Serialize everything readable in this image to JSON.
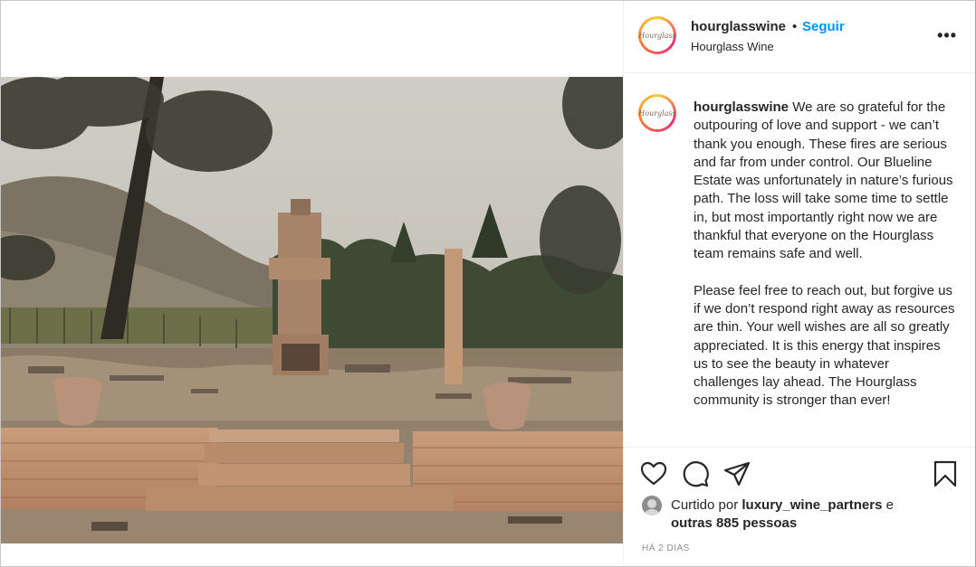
{
  "post": {
    "username": "hourglasswine",
    "dot": "•",
    "follow_label": "Seguir",
    "location": "Hourglass Wine",
    "more_label": "•••",
    "avatar_text": "Hourglass",
    "caption_username": "hourglasswine",
    "caption_p1": "We are so grateful for the outpouring of love and support - we can’t thank you enough. These fires are serious and far from under control. Our Blueline Estate was unfortunately in nature’s furious path. The loss will take some time to settle in, but most importantly right now we are thankful that everyone on the Hourglass team remains safe and well.",
    "caption_p2": "Please feel free to reach out, but forgive us if we don’t respond right away as resources are thin. Your well wishes are all so greatly appreciated. It is this energy that inspires us to see the beauty in whatever challenges lay ahead. The Hourglass community is stronger than ever!",
    "likes_prefix": "Curtido por",
    "likes_user": "luxury_wine_partners",
    "likes_mid": "e",
    "likes_others": "outras 885 pessoas",
    "timestamp": "HÁ 2 DIAS"
  },
  "icons": [
    "heart-icon",
    "comment-icon",
    "share-icon",
    "bookmark-icon",
    "more-icon"
  ],
  "colors": {
    "follow": "#0095f6",
    "text": "#262626",
    "muted": "#8e8e8e",
    "divider": "#efefef"
  }
}
